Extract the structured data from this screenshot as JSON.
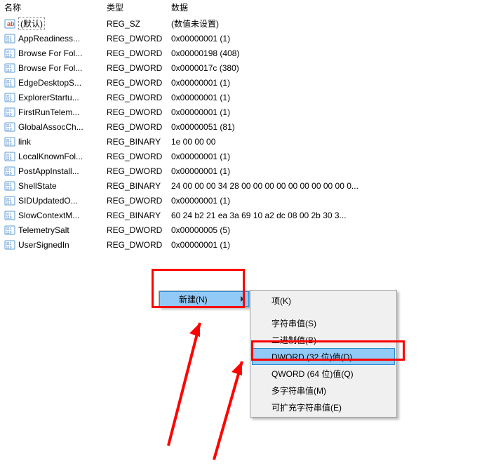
{
  "columns": {
    "name": "名称",
    "type": "类型",
    "data": "数据"
  },
  "rows": [
    {
      "icon": "string",
      "name": "(默认)",
      "type": "REG_SZ",
      "data": "(数值未设置)",
      "default": true
    },
    {
      "icon": "binary",
      "name": "AppReadiness...",
      "type": "REG_DWORD",
      "data": "0x00000001 (1)"
    },
    {
      "icon": "binary",
      "name": "Browse For Fol...",
      "type": "REG_DWORD",
      "data": "0x00000198 (408)"
    },
    {
      "icon": "binary",
      "name": "Browse For Fol...",
      "type": "REG_DWORD",
      "data": "0x0000017c (380)"
    },
    {
      "icon": "binary",
      "name": "EdgeDesktopS...",
      "type": "REG_DWORD",
      "data": "0x00000001 (1)"
    },
    {
      "icon": "binary",
      "name": "ExplorerStartu...",
      "type": "REG_DWORD",
      "data": "0x00000001 (1)"
    },
    {
      "icon": "binary",
      "name": "FirstRunTelem...",
      "type": "REG_DWORD",
      "data": "0x00000001 (1)"
    },
    {
      "icon": "binary",
      "name": "GlobalAssocCh...",
      "type": "REG_DWORD",
      "data": "0x00000051 (81)"
    },
    {
      "icon": "binary",
      "name": "link",
      "type": "REG_BINARY",
      "data": "1e 00 00 00"
    },
    {
      "icon": "binary",
      "name": "LocalKnownFol...",
      "type": "REG_DWORD",
      "data": "0x00000001 (1)"
    },
    {
      "icon": "binary",
      "name": "PostAppInstall...",
      "type": "REG_DWORD",
      "data": "0x00000001 (1)"
    },
    {
      "icon": "binary",
      "name": "ShellState",
      "type": "REG_BINARY",
      "data": "24 00 00 00 34 28 00 00 00 00 00 00 00 00 00 0..."
    },
    {
      "icon": "binary",
      "name": "SIDUpdatedO...",
      "type": "REG_DWORD",
      "data": "0x00000001 (1)"
    },
    {
      "icon": "binary",
      "name": "SlowContextM...",
      "type": "REG_BINARY",
      "data": "60 24 b2 21 ea 3a 69 10 a2 dc 08 00 2b 30 3..."
    },
    {
      "icon": "binary",
      "name": "TelemetrySalt",
      "type": "REG_DWORD",
      "data": "0x00000005 (5)"
    },
    {
      "icon": "binary",
      "name": "UserSignedIn",
      "type": "REG_DWORD",
      "data": "0x00000001 (1)"
    }
  ],
  "context_primary": {
    "new": "新建(N)"
  },
  "context_secondary": {
    "key": "项(K)",
    "string": "字符串值(S)",
    "binary": "二进制值(B)",
    "dword": "DWORD (32 位)值(D)",
    "qword": "QWORD (64 位)值(Q)",
    "multi": "多字符串值(M)",
    "expand": "可扩充字符串值(E)"
  }
}
